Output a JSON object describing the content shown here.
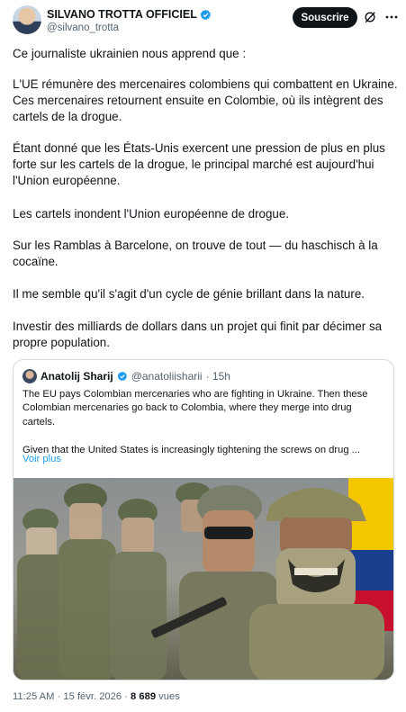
{
  "header": {
    "display_name": "SILVANO TROTTA OFFICIEL",
    "handle": "@silvano_trotta",
    "follow_label": "Souscrire"
  },
  "post": {
    "paragraphs": [
      "Ce journaliste ukrainien nous apprend que :",
      "L'UE rémunère des mercenaires colombiens qui combattent en Ukraine.\nCes mercenaires retournent ensuite en Colombie, où ils intègrent des\ncartels de la drogue.",
      "Étant donné que les États-Unis exercent une pression de plus en plus\nforte sur les cartels de la drogue, le principal marché est aujourd'hui\nl'Union européenne.",
      "Les cartels inondent l'Union européenne de drogue.",
      "Sur les Ramblas à Barcelone, on trouve de tout — du haschisch à la\ncocaïne.",
      "Il me semble qu'il s'agit d'un cycle de génie brillant dans la nature.",
      "Investir des milliards de dollars dans un projet qui finit par décimer sa\npropre population."
    ]
  },
  "quote": {
    "name": "Anatolij Sharij",
    "handle": "@anatoliisharii",
    "time": "· 15h",
    "text": "The EU pays Colombian mercenaries who are fighting in Ukraine. Then these\nColombian mercenaries go back to Colombia, where they merge into drug\ncartels.\n\nGiven that the United States is increasingly tightening the screws on drug ...",
    "more_label": "Voir plus"
  },
  "meta": {
    "time": "11:25 AM",
    "separator1": " · ",
    "date": "15 févr. 2026",
    "separator2": " · ",
    "views_count": "8 689",
    "views_label": " vues"
  },
  "colors": {
    "text": "#0f1419",
    "secondary": "#536471",
    "link": "#1d9bf0",
    "verified": "#1d9bf0"
  }
}
